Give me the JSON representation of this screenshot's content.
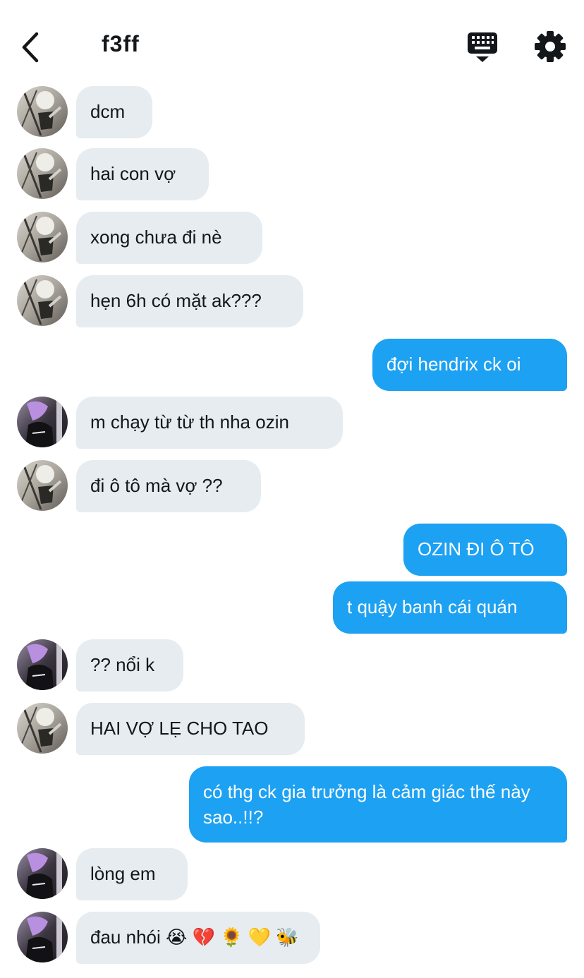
{
  "header": {
    "title": "f3ff",
    "back_icon": "chevron-left-icon",
    "keyboard_icon": "keyboard-icon",
    "settings_icon": "gear-icon"
  },
  "colors": {
    "incoming_bubble": "#e6ecf0",
    "outgoing_bubble": "#1da1f2",
    "text_dark": "#14171a"
  },
  "messages": [
    {
      "dir": "in",
      "avatar": "avatar-a",
      "text": "dcm"
    },
    {
      "dir": "in",
      "avatar": "avatar-a",
      "text": "hai con vợ"
    },
    {
      "dir": "in",
      "avatar": "avatar-a",
      "text": "xong chưa đi nè"
    },
    {
      "dir": "in",
      "avatar": "avatar-a",
      "text": "hẹn 6h có mặt ak???"
    },
    {
      "dir": "out",
      "text": "đợi hendrix ck oi"
    },
    {
      "dir": "in",
      "avatar": "avatar-b",
      "text": "m chạy từ từ th nha ozin"
    },
    {
      "dir": "in",
      "avatar": "avatar-a",
      "text": "đi ô tô mà vợ ??"
    },
    {
      "dir": "out",
      "text": "OZIN ĐI Ô TÔ"
    },
    {
      "dir": "out",
      "text": "t quậy banh cái quán"
    },
    {
      "dir": "in",
      "avatar": "avatar-b",
      "text": "?? nổi k"
    },
    {
      "dir": "in",
      "avatar": "avatar-a",
      "text": "HAI VỢ LẸ CHO TAO"
    },
    {
      "dir": "out",
      "text": "có thg ck gia trưởng là cảm giác thế này sao..!!?"
    },
    {
      "dir": "in",
      "avatar": "avatar-b",
      "text": "lòng em"
    },
    {
      "dir": "in",
      "avatar": "avatar-b",
      "text": "đau nhói 😭 💔 🌻 💛 🐝"
    }
  ]
}
